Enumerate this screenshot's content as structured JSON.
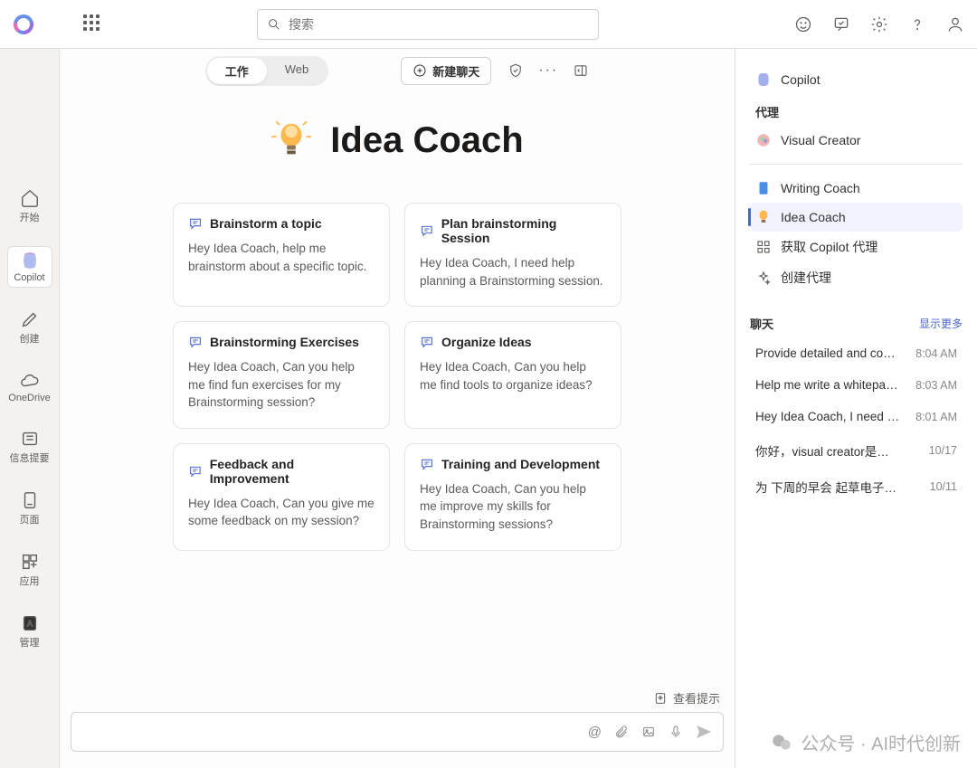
{
  "topbar": {
    "search_placeholder": "搜索"
  },
  "rail": {
    "items": [
      {
        "label": "开始"
      },
      {
        "label": "Copilot"
      },
      {
        "label": "创建"
      },
      {
        "label": "OneDrive"
      },
      {
        "label": "信息提要"
      },
      {
        "label": "页面"
      },
      {
        "label": "应用"
      },
      {
        "label": "管理"
      }
    ]
  },
  "toolbar": {
    "tab_work": "工作",
    "tab_web": "Web",
    "new_chat": "新建聊天"
  },
  "hero": {
    "title": "Idea Coach"
  },
  "cards": [
    {
      "title": "Brainstorm a topic",
      "body": "Hey Idea Coach, help me brainstorm about a specific topic."
    },
    {
      "title": "Plan brainstorming Session",
      "body": "Hey Idea Coach, I need help planning a Brainstorming session."
    },
    {
      "title": "Brainstorming Exercises",
      "body": "Hey Idea Coach, Can you help me find fun exercises for my Brainstorming session?"
    },
    {
      "title": "Organize Ideas",
      "body": "Hey Idea Coach, Can you help me find tools to organize ideas?"
    },
    {
      "title": "Feedback and Improvement",
      "body": "Hey Idea Coach, Can you give me some feedback on my session?"
    },
    {
      "title": "Training and Development",
      "body": "Hey Idea Coach, Can you help me improve my skills for Brainstorming sessions?"
    }
  ],
  "footer": {
    "hint_label": "查看提示"
  },
  "right_panel": {
    "copilot_label": "Copilot",
    "agents_label": "代理",
    "agents": [
      {
        "name": "Visual Creator"
      },
      {
        "name": "Writing Coach"
      },
      {
        "name": "Idea Coach"
      },
      {
        "name": "获取 Copilot 代理"
      },
      {
        "name": "创建代理"
      }
    ],
    "chats_label": "聊天",
    "more_label": "显示更多",
    "chats": [
      {
        "title": "Provide detailed and cons...",
        "time": "8:04 AM"
      },
      {
        "title": "Help me write a whitepap...",
        "time": "8:03 AM"
      },
      {
        "title": "Hey Idea Coach, I need h...",
        "time": "8:01 AM"
      },
      {
        "title": "你好，visual creator是做什...",
        "time": "10/17"
      },
      {
        "title": "为 下周的早会 起草电子邮...",
        "time": "10/11"
      }
    ]
  },
  "watermark": {
    "text": "公众号 · AI时代创新"
  }
}
